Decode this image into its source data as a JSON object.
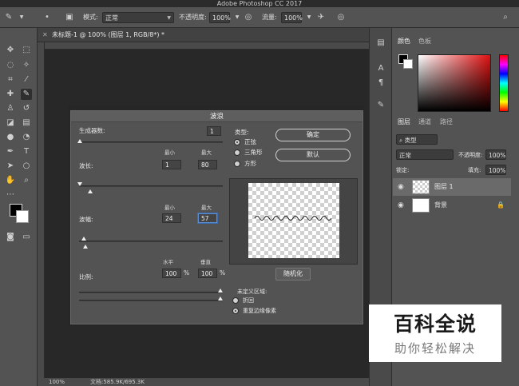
{
  "app": {
    "title": "Adobe Photoshop CC 2017"
  },
  "options_bar": {
    "mode_label": "模式:",
    "mode_value": "正常",
    "opacity_label": "不透明度:",
    "opacity_value": "100%",
    "flow_label": "流量:",
    "flow_value": "100%"
  },
  "document": {
    "tab_title": "未标题-1 @ 100% (图层 1, RGB/8*) *",
    "zoom": "100%",
    "doc_size": "文档:585.9K/695.3K"
  },
  "dialog": {
    "title": "波浪",
    "generators_label": "生成器数:",
    "generators_value": "1",
    "min_label": "最小",
    "max_label": "最大",
    "wavelength_label": "波长:",
    "wavelength_min": "1",
    "wavelength_max": "80",
    "amplitude_label": "波幅:",
    "amplitude_min": "24",
    "amplitude_max": "57",
    "horizontal_label": "水平",
    "vertical_label": "垂直",
    "scale_label": "比例:",
    "scale_h": "100",
    "scale_v": "100",
    "percent": "%",
    "type_label": "类型:",
    "type_options": [
      "正弦",
      "三角形",
      "方形"
    ],
    "type_selected": 0,
    "ok_button": "确定",
    "default_button": "默认",
    "randomize_button": "随机化",
    "undefined_label": "未定义区域:",
    "undefined_options": [
      "折回",
      "重复边缘像素"
    ],
    "undefined_selected": 1
  },
  "color_panel": {
    "tabs": [
      "颜色",
      "色板"
    ]
  },
  "layers_panel": {
    "tabs": [
      "图层",
      "通道",
      "路径"
    ],
    "filter_value": "类型",
    "blend_value": "正常",
    "opacity_label": "不透明度:",
    "opacity_value": "100%",
    "lock_label": "锁定:",
    "fill_label": "填充:",
    "fill_value": "100%",
    "layers": [
      {
        "name": "图层 1",
        "selected": true
      },
      {
        "name": "背景",
        "selected": false
      }
    ]
  },
  "watermark": {
    "title": "百科全说",
    "subtitle": "助你轻松解决"
  }
}
